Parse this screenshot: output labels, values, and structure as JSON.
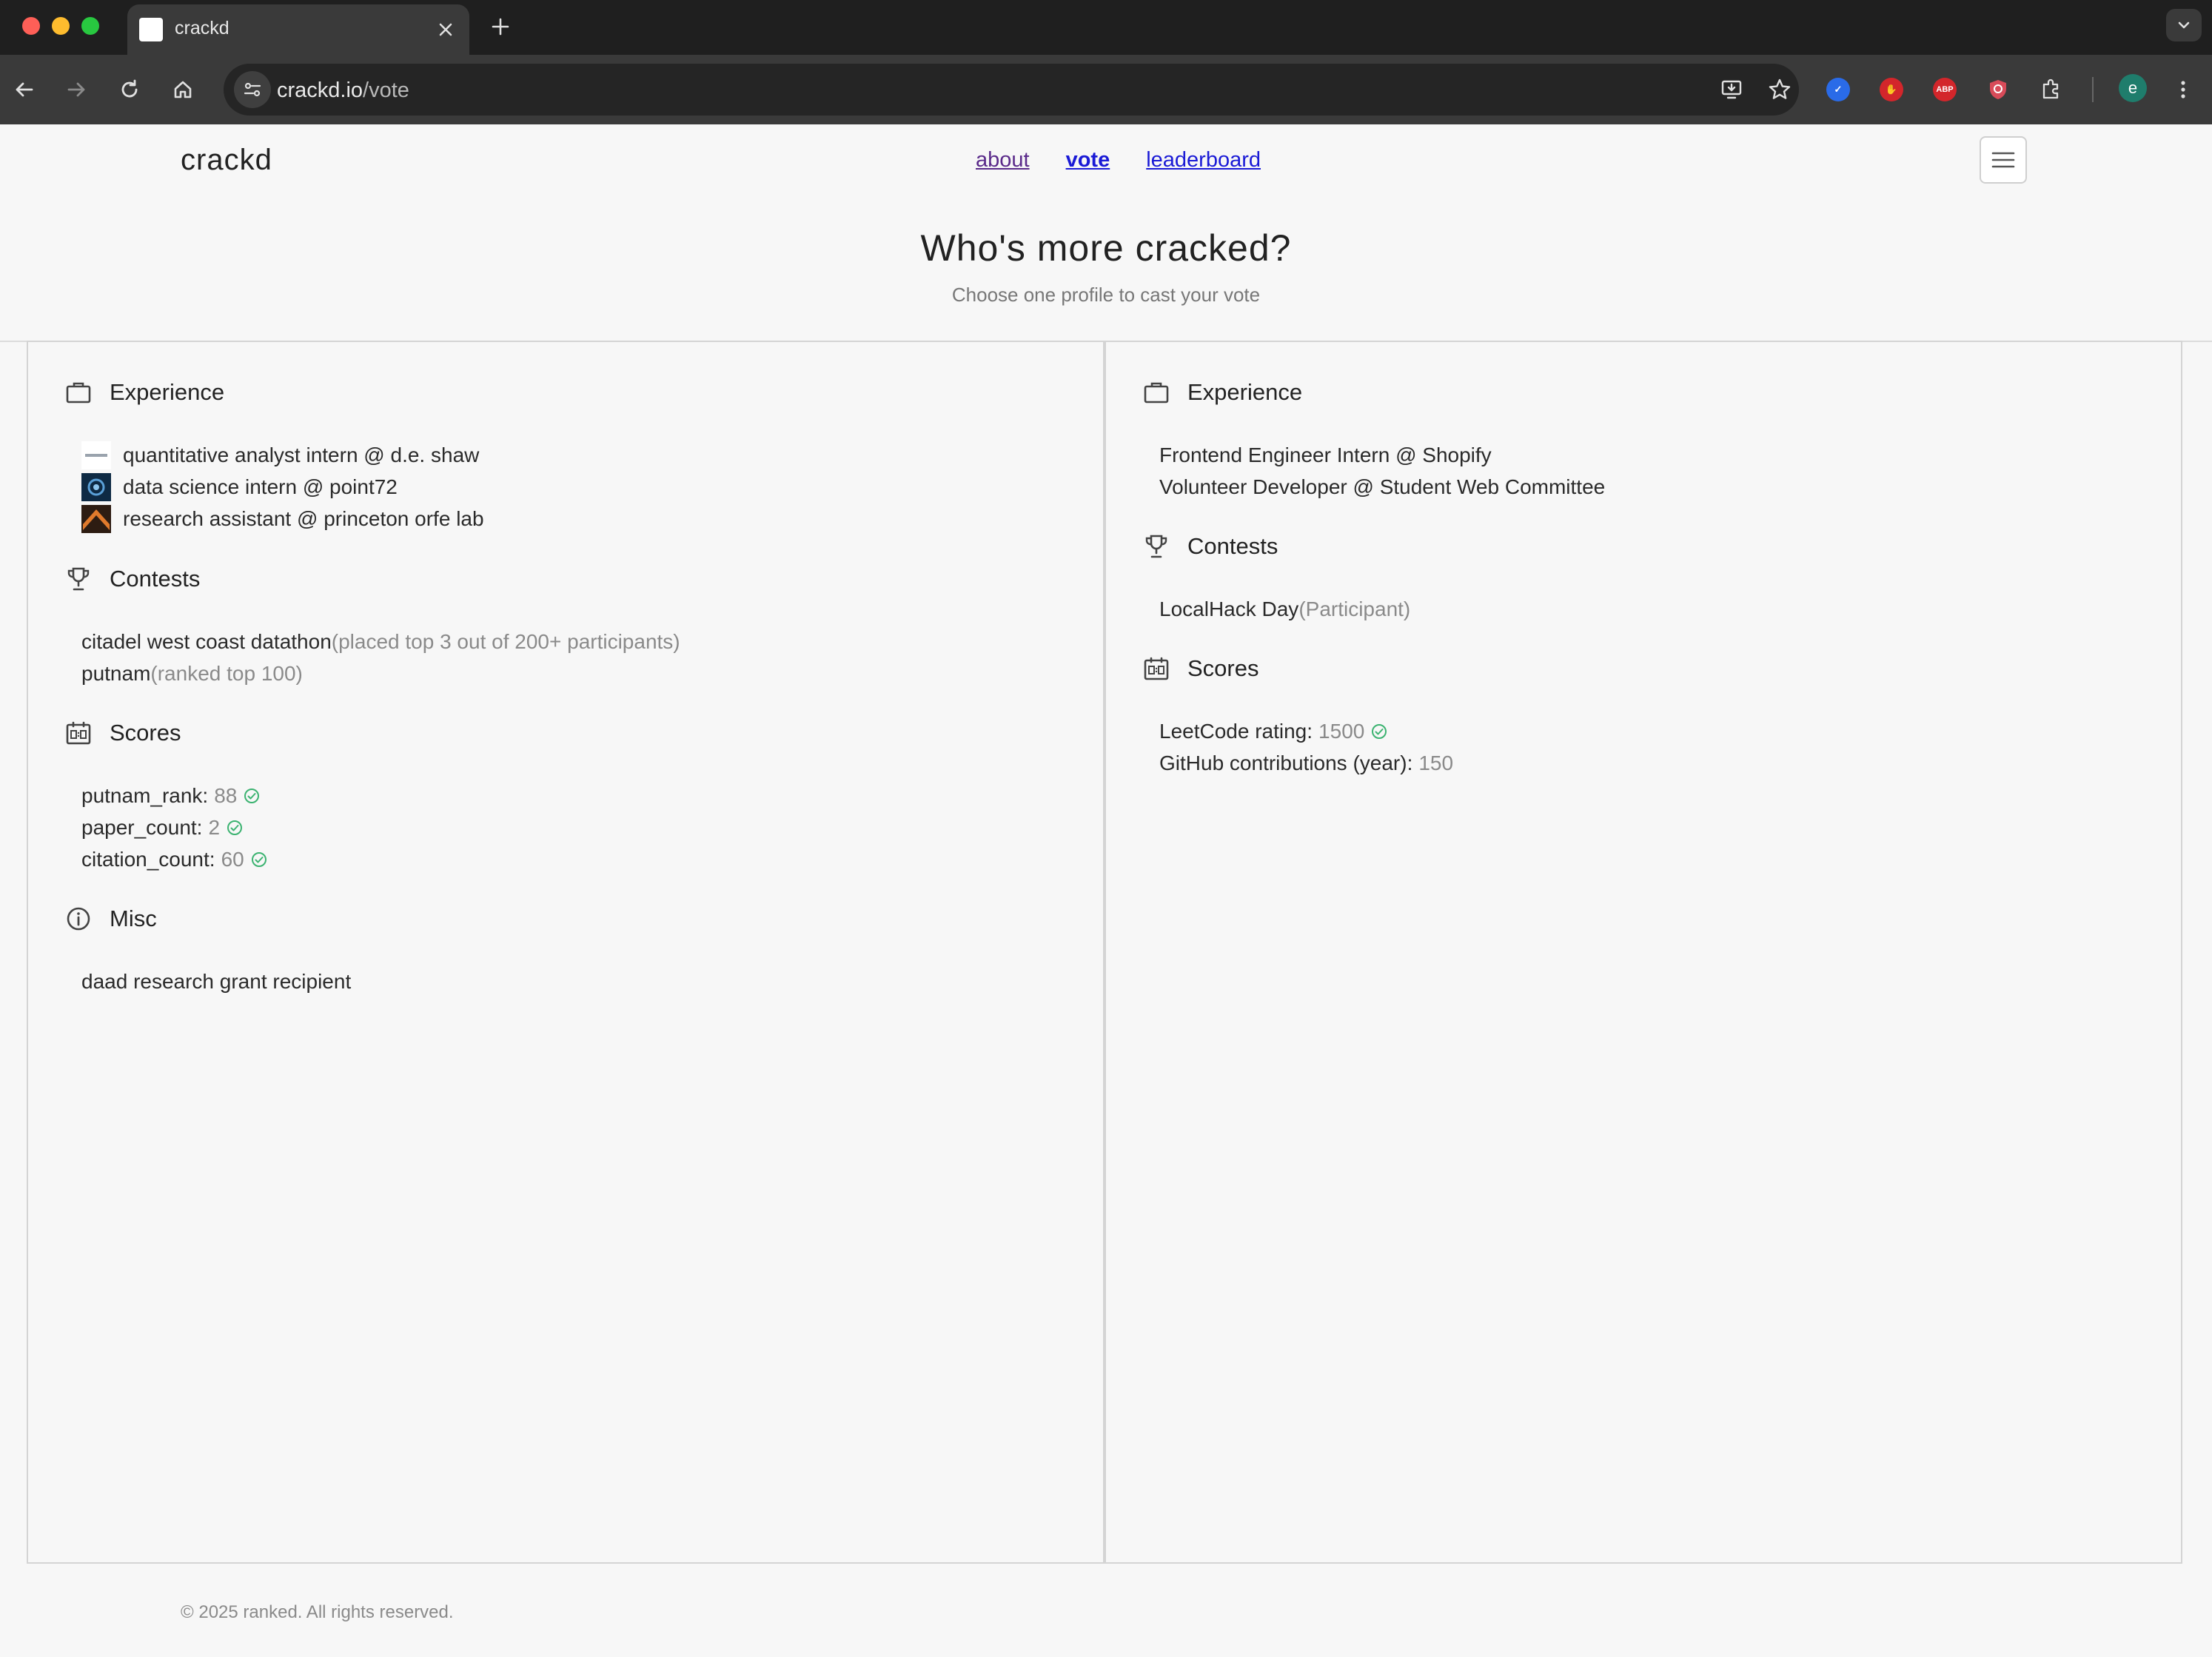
{
  "browser": {
    "tab_title": "crackd",
    "url_host": "crackd.io",
    "url_path": "/vote",
    "profile_initial": "e",
    "extensions": [
      "twitter-verified-icon",
      "block-hand-icon",
      "adblock-plus-icon",
      "shield-icon",
      "puzzle-icon"
    ]
  },
  "header": {
    "brand": "crackd",
    "nav": [
      {
        "label": "about"
      },
      {
        "label": "vote"
      },
      {
        "label": "leaderboard"
      }
    ]
  },
  "main": {
    "title": "Who's more cracked?",
    "subtitle": "Choose one profile to cast your vote"
  },
  "profiles": [
    {
      "experience_heading": "Experience",
      "experience": [
        {
          "label": "quantitative analyst intern @ d.e. shaw"
        },
        {
          "label": "data science intern @ point72"
        },
        {
          "label": "research assistant @ princeton orfe lab"
        }
      ],
      "contests_heading": "Contests",
      "contests": [
        {
          "name": "citadel west coast datathon",
          "note": "(placed top 3 out of 200+ participants)"
        },
        {
          "name": "putnam",
          "note": "(ranked top 100)"
        }
      ],
      "scores_heading": "Scores",
      "scores": [
        {
          "key": "putnam_rank:",
          "value": "88",
          "verified": true
        },
        {
          "key": "paper_count:",
          "value": "2",
          "verified": true
        },
        {
          "key": "citation_count:",
          "value": "60",
          "verified": true
        }
      ],
      "misc_heading": "Misc",
      "misc": [
        {
          "label": "daad research grant recipient"
        }
      ]
    },
    {
      "experience_heading": "Experience",
      "experience": [
        {
          "label": "Frontend Engineer Intern @ Shopify"
        },
        {
          "label": "Volunteer Developer @ Student Web Committee"
        }
      ],
      "contests_heading": "Contests",
      "contests": [
        {
          "name": "LocalHack Day",
          "note": "(Participant)"
        }
      ],
      "scores_heading": "Scores",
      "scores": [
        {
          "key": "LeetCode rating:",
          "value": "1500",
          "verified": true
        },
        {
          "key": "GitHub contributions (year):",
          "value": "150",
          "verified": false
        }
      ]
    }
  ],
  "footer": {
    "text": "© 2025 ranked. All rights reserved."
  },
  "colors": {
    "verified": "#3cb371",
    "link": "#1a1ad6",
    "visited_link": "#5a2a8a"
  }
}
